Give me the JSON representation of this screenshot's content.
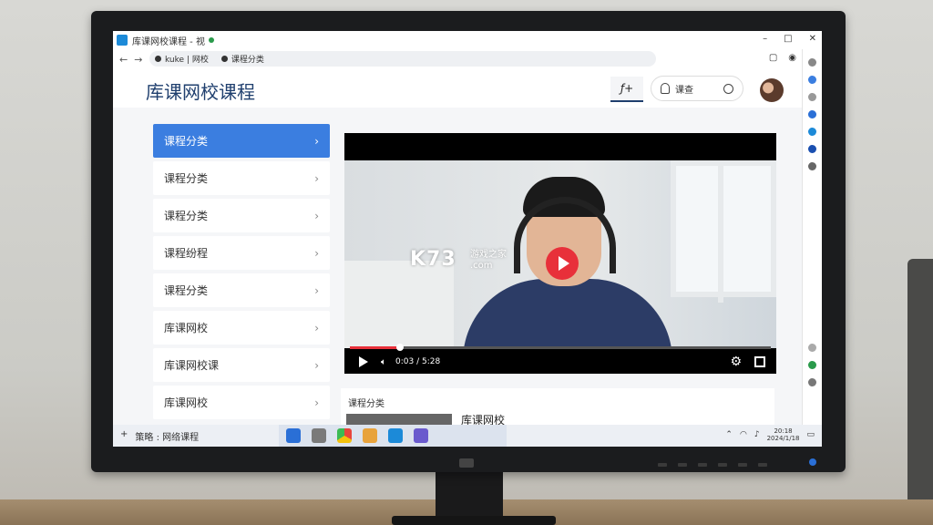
{
  "browser": {
    "tab_title": "库课网校课程 - 视",
    "window_controls": [
      "–",
      "□",
      "✕"
    ],
    "url_segments": [
      "kuke | 网校",
      "课程分类"
    ],
    "nav": {
      "back": "←",
      "forward": "→"
    }
  },
  "site": {
    "logo": "库课网校课程",
    "header_button": "ƒ+",
    "search_label": "课查"
  },
  "sidebar": {
    "items": [
      {
        "label": "课程分类",
        "active": true
      },
      {
        "label": "课程分类",
        "active": false
      },
      {
        "label": "课程分类",
        "active": false
      },
      {
        "label": "课程纷程",
        "active": false
      },
      {
        "label": "课程分类",
        "active": false
      },
      {
        "label": "库课网校",
        "active": false
      },
      {
        "label": "库课网校课",
        "active": false
      },
      {
        "label": "库课网校",
        "active": false
      }
    ],
    "chevron": "›"
  },
  "video": {
    "watermark": "K73",
    "watermark_sub_1": "游戏之家",
    "watermark_sub_2": ".com",
    "time": "0:03 / 5:28",
    "progress": 0.12,
    "colors": {
      "accent": "#e8303a"
    }
  },
  "related": {
    "title": "课程分类",
    "item_name": "库课网校"
  },
  "taskbar": {
    "status": "策略 : 网络课程",
    "add": "+",
    "time": "20:18",
    "date": "2024/1/18"
  },
  "colors": {
    "primary": "#3b7ee0",
    "logo": "#1f3f6e"
  }
}
